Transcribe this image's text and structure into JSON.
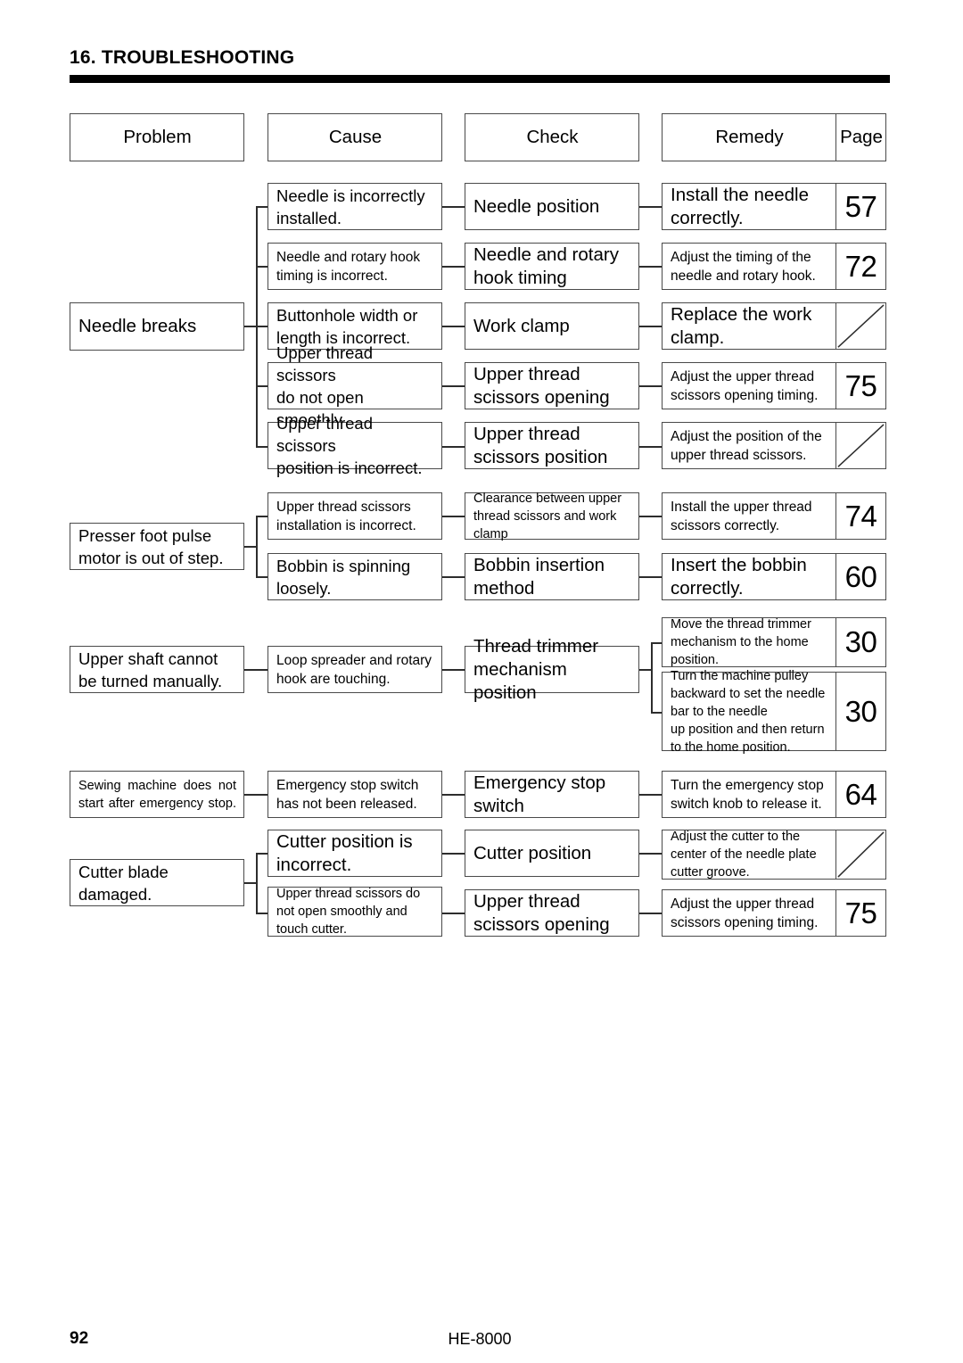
{
  "header": {
    "title": "16. TROUBLESHOOTING"
  },
  "columns": {
    "problem": "Problem",
    "cause": "Cause",
    "check": "Check",
    "remedy": "Remedy",
    "page": "Page"
  },
  "groups": [
    {
      "problem": "Needle breaks",
      "rows": [
        {
          "cause": "Needle is incorrectly\ninstalled.",
          "check": "Needle position",
          "remedy": "Install the needle\ncorrectly.",
          "page": "57"
        },
        {
          "cause": "Needle and rotary hook\ntiming is incorrect.",
          "check": "Needle and rotary\nhook timing",
          "remedy": "Adjust the timing of the\nneedle and rotary hook.",
          "page": "72"
        },
        {
          "cause": "Buttonhole width or\nlength is incorrect.",
          "check": "Work clamp",
          "remedy": "Replace the work\nclamp.",
          "page": ""
        },
        {
          "cause": "Upper thread scissors\ndo not open smoothly.",
          "check": "Upper thread\nscissors opening",
          "remedy": "Adjust the upper thread\nscissors opening timing.",
          "page": "75"
        },
        {
          "cause": "Upper thread scissors\nposition is incorrect.",
          "check": "Upper thread\nscissors position",
          "remedy": "Adjust the position of the\nupper thread scissors.",
          "page": ""
        }
      ]
    },
    {
      "problem": "Presser foot pulse\nmotor is out of step.",
      "rows": [
        {
          "cause": "Upper thread scissors\ninstallation is incorrect.",
          "check": "Clearance between upper\nthread scissors and work\nclamp",
          "remedy": "Install the upper thread\nscissors correctly.",
          "page": "74"
        },
        {
          "cause": "Bobbin is spinning\nloosely.",
          "check": "Bobbin insertion\nmethod",
          "remedy": "Insert the bobbin\ncorrectly.",
          "page": "60"
        }
      ]
    },
    {
      "problem": "Upper shaft cannot\nbe turned manually.",
      "rows": [
        {
          "cause": "Loop spreader and rotary\nhook are touching.",
          "check": "Thread trimmer\nmechanism position",
          "remedies": [
            {
              "remedy": "Move the thread trimmer\nmechanism to the home\nposition.",
              "page": "30"
            },
            {
              "remedy": "Turn the machine pulley\nbackward to set the needle\nbar to the needle\n up position and then return\nto the home position.",
              "page": "30"
            }
          ]
        }
      ]
    },
    {
      "problem": "Sewing machine does not\nstart after emergency stop.",
      "rows": [
        {
          "cause": "Emergency stop switch\nhas not been released.",
          "check": "Emergency stop\nswitch",
          "remedy": "Turn the emergency stop\nswitch knob to release it.",
          "page": "64"
        }
      ]
    },
    {
      "problem": "Cutter blade damaged.",
      "rows": [
        {
          "cause": "Cutter position is\nincorrect.",
          "check": "Cutter position",
          "remedy": "Adjust the cutter to the\ncenter of the needle plate\ncutter groove.",
          "page": ""
        },
        {
          "cause": "Upper thread scissors do\nnot open smoothly and\ntouch cutter.",
          "check": "Upper thread\nscissors opening",
          "remedy": "Adjust the upper thread\nscissors opening timing.",
          "page": "75"
        }
      ]
    }
  ],
  "footer": {
    "page_number": "92",
    "model": "HE-8000"
  }
}
